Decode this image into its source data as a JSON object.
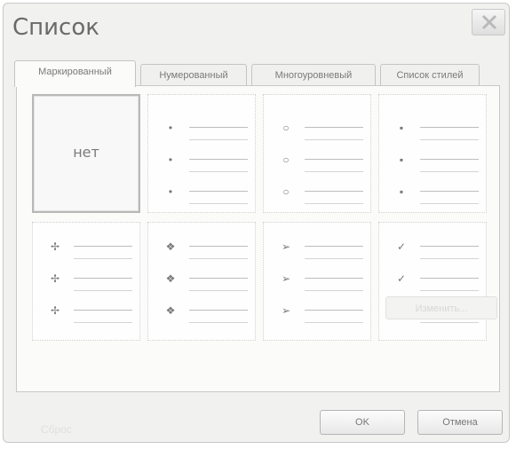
{
  "window": {
    "title": "Список"
  },
  "tabs": [
    {
      "label": "Маркированный",
      "selected": true
    },
    {
      "label": "Нумерованный",
      "selected": false
    },
    {
      "label": "Многоуровневый",
      "selected": false
    },
    {
      "label": "Список стилей",
      "selected": false
    }
  ],
  "gallery": {
    "none_label": "нет",
    "cells": [
      {
        "icon": "none",
        "glyph": ""
      },
      {
        "icon": "small-dot-bullet-icon",
        "glyph": "•"
      },
      {
        "icon": "hollow-circle-bullet-icon",
        "glyph": "○"
      },
      {
        "icon": "square-bullet-icon",
        "glyph": "▪"
      },
      {
        "icon": "pushpin-bullet-icon",
        "glyph": "✢"
      },
      {
        "icon": "four-diamond-bullet-icon",
        "glyph": "❖"
      },
      {
        "icon": "arrowhead-bullet-icon",
        "glyph": "➢"
      },
      {
        "icon": "checkmark-bullet-icon",
        "glyph": "✓"
      }
    ]
  },
  "buttons": {
    "change": "Изменить...",
    "reset": "Сброс",
    "ok": "OK",
    "cancel": "Отмена"
  },
  "colors": {
    "selected_cell_border": "#b8b8b8",
    "dialog_bg": "#f1f1ef"
  }
}
